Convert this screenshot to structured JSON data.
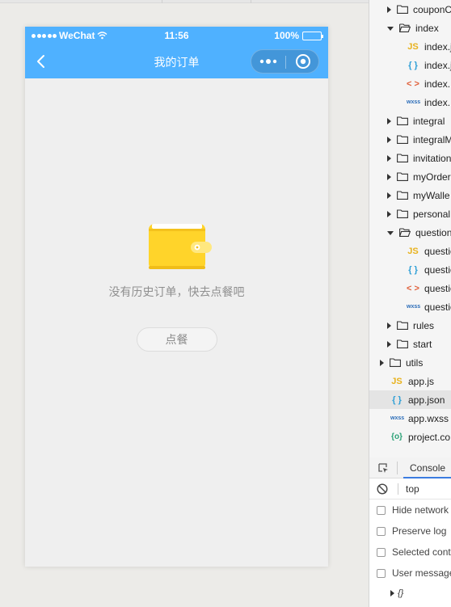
{
  "simulator": {
    "status_bar": {
      "carrier": "WeChat",
      "time": "11:56",
      "battery": "100%"
    },
    "nav_bar": {
      "title": "我的订单"
    },
    "empty_state": {
      "message": "没有历史订单，快去点餐吧",
      "button_label": "点餐"
    },
    "colors": {
      "nav_background": "#4fb1ff",
      "page_background": "#efefef",
      "wallet_yellow": "#ffd42a"
    }
  },
  "file_tree": {
    "rows": [
      {
        "label": "couponC",
        "kind": "folder",
        "expanded": false
      },
      {
        "label": "index",
        "kind": "folder",
        "expanded": true
      },
      {
        "label": "index.j",
        "kind": "js",
        "icon": "JS"
      },
      {
        "label": "index.j",
        "kind": "json",
        "icon": "{ }"
      },
      {
        "label": "index.",
        "kind": "wxml",
        "icon": "< >"
      },
      {
        "label": "index.",
        "kind": "wxss",
        "icon": "wxss"
      },
      {
        "label": "integral",
        "kind": "folder",
        "expanded": false
      },
      {
        "label": "integralM",
        "kind": "folder",
        "expanded": false
      },
      {
        "label": "invitation",
        "kind": "folder",
        "expanded": false
      },
      {
        "label": "myOrder",
        "kind": "folder",
        "expanded": false
      },
      {
        "label": "myWalle",
        "kind": "folder",
        "expanded": false
      },
      {
        "label": "personal",
        "kind": "folder",
        "expanded": false
      },
      {
        "label": "question",
        "kind": "folder",
        "expanded": true
      },
      {
        "label": "questio",
        "kind": "js",
        "icon": "JS"
      },
      {
        "label": "questio",
        "kind": "json",
        "icon": "{ }"
      },
      {
        "label": "questio",
        "kind": "wxml",
        "icon": "< >"
      },
      {
        "label": "questio",
        "kind": "wxss",
        "icon": "wxss"
      },
      {
        "label": "rules",
        "kind": "folder",
        "expanded": false
      },
      {
        "label": "start",
        "kind": "folder",
        "expanded": false
      },
      {
        "label": "utils",
        "kind": "folder",
        "expanded": false
      },
      {
        "label": "app.js",
        "kind": "js",
        "icon": "JS"
      },
      {
        "label": "app.json",
        "kind": "json",
        "icon": "{ }",
        "selected": true
      },
      {
        "label": "app.wxss",
        "kind": "wxss",
        "icon": "wxss"
      },
      {
        "label": "project.co",
        "kind": "config",
        "icon": "{o}"
      }
    ]
  },
  "console": {
    "tab_label": "Console",
    "context": "top",
    "options": [
      "Hide network",
      "Preserve log",
      "Selected conte",
      "User messages"
    ],
    "object_preview": "{}"
  }
}
